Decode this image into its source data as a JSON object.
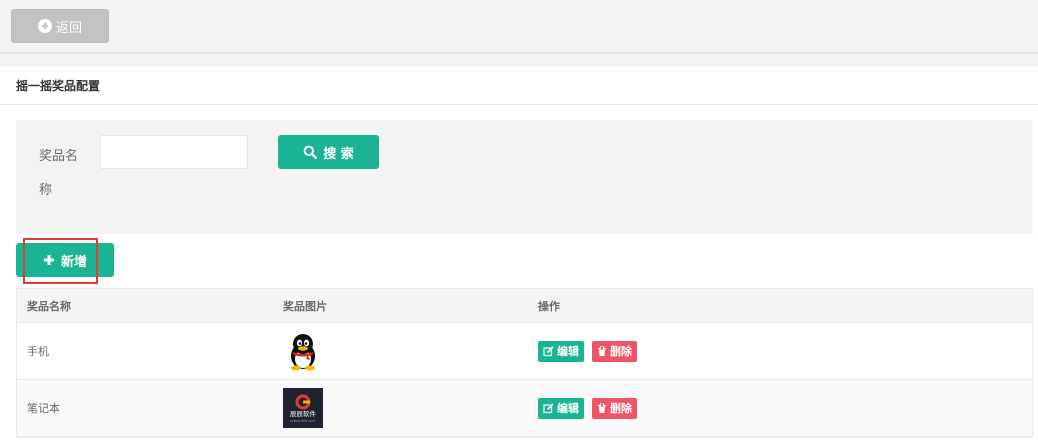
{
  "toolbar": {
    "back_label": "返回"
  },
  "panel": {
    "title": "摇一摇奖品配置"
  },
  "search": {
    "label": "奖品名称",
    "input_value": "",
    "button_label": "搜 索"
  },
  "actions": {
    "add_label": "新增"
  },
  "table": {
    "columns": [
      "奖品名称",
      "奖品图片",
      "操作"
    ],
    "rows": [
      {
        "name": "手机",
        "image": "qq-penguin-image",
        "edit_label": "编辑",
        "delete_label": "删除"
      },
      {
        "name": "笔记本",
        "image": "company-logo-image",
        "edit_label": "编辑",
        "delete_label": "删除"
      }
    ]
  },
  "logo_text": {
    "line1": "辰辰软件",
    "line2": "CHENCHEN SOFT"
  },
  "colors": {
    "primary": "#1ab394",
    "danger": "#ed5565",
    "back_button": "#c2c2c2",
    "highlight": "#e53935"
  }
}
